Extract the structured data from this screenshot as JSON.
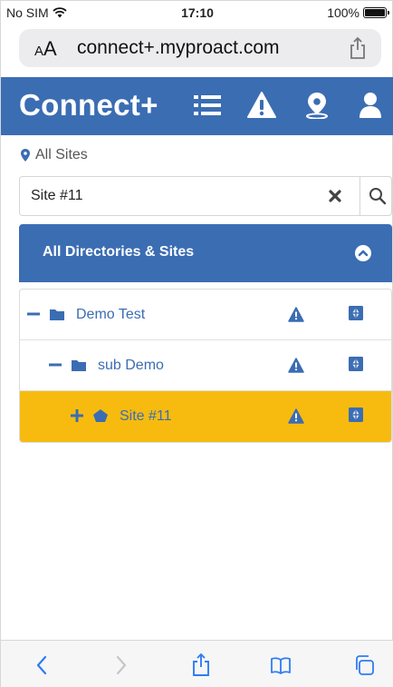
{
  "status_bar": {
    "carrier": "No SIM",
    "time": "17:10",
    "battery": "100%",
    "battery_level": 1.0
  },
  "browser": {
    "text_size_label": "AA",
    "url": "connect+.myproact.com"
  },
  "app": {
    "brand": "Connect+",
    "icons": [
      "list-icon",
      "warning-icon",
      "location-pin-icon",
      "user-icon"
    ],
    "accent_color": "#3b6db3",
    "selected_color": "#f7bb0f"
  },
  "breadcrumb": {
    "label": "All Sites"
  },
  "search": {
    "value": "Site #11",
    "placeholder": ""
  },
  "directory": {
    "title": "All Directories & Sites",
    "rows": [
      {
        "expander": "minus",
        "kind": "folder",
        "label": "Demo Test",
        "level": 0,
        "selected": false
      },
      {
        "expander": "minus",
        "kind": "folder",
        "label": "sub Demo",
        "level": 1,
        "selected": false
      },
      {
        "expander": "plus",
        "kind": "site",
        "label": "Site #11",
        "level": 2,
        "selected": true
      }
    ]
  },
  "toolbar": {
    "icons": [
      "back-icon",
      "forward-icon",
      "share-icon",
      "bookmarks-icon",
      "tabs-icon"
    ]
  }
}
